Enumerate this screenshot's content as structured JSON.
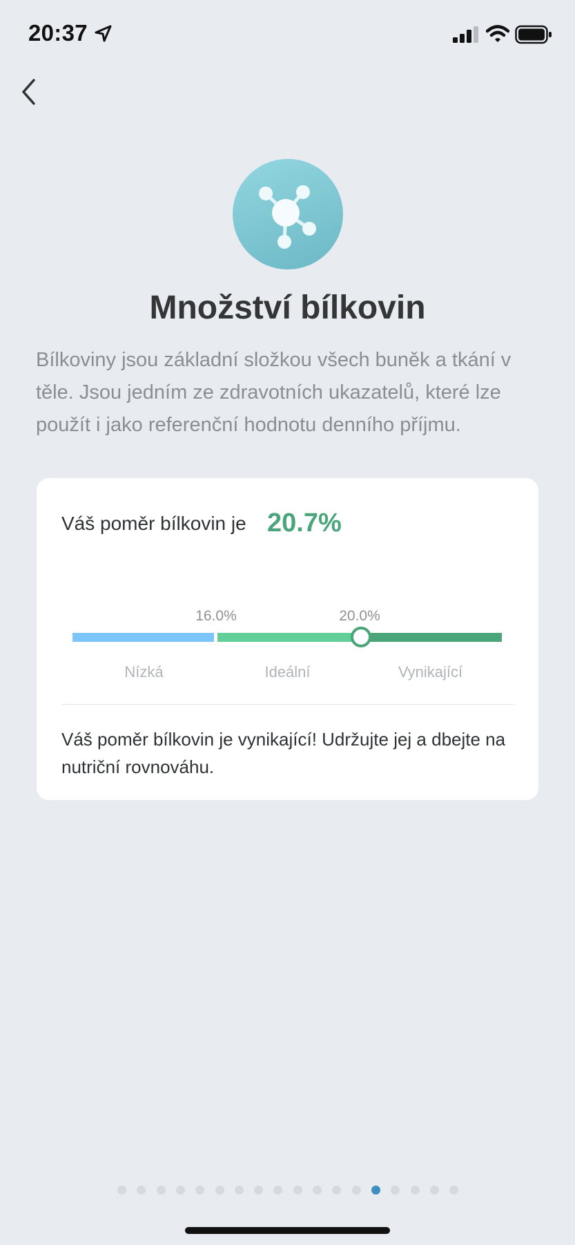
{
  "status_bar": {
    "time": "20:37"
  },
  "header": {
    "back_icon": "chevron-left-icon"
  },
  "hero": {
    "icon": "molecule-icon",
    "title": "Množství bílkovin",
    "description": "Bílkoviny jsou základní složkou všech buněk a tkání v těle. Jsou jedním ze zdravotních ukazatelů, které lze použít i jako referenční hodnotu denního příjmu."
  },
  "card": {
    "ratio_label": "Váš poměr bílkovin je",
    "ratio_value": "20.7%",
    "thresholds": [
      "16.0%",
      "20.0%"
    ],
    "ranges": [
      "Nízká",
      "Ideální",
      "Vynikající"
    ],
    "message": "Váš poměr bílkovin je vynikající! Udržujte jej a dbejte na nutriční rovnováhu.",
    "colors": {
      "low": "#7cc5fa",
      "ideal": "#63cf98",
      "excellent": "#4aa57a"
    }
  },
  "pagination": {
    "total": 18,
    "active_index": 13,
    "active_color": "#3d8fbd"
  }
}
